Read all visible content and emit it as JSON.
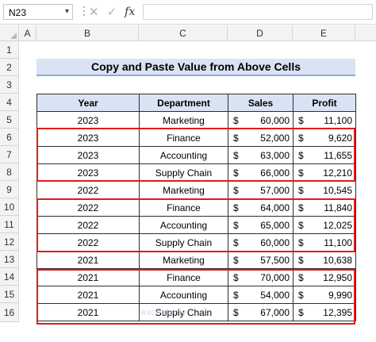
{
  "formula_bar": {
    "name_box": "N23",
    "cancel_icon": "✕",
    "enter_icon": "✓",
    "fx_label": "fx",
    "formula": ""
  },
  "columns": [
    "A",
    "B",
    "C",
    "D",
    "E"
  ],
  "rows": [
    "1",
    "2",
    "3",
    "4",
    "5",
    "6",
    "7",
    "8",
    "9",
    "10",
    "11",
    "12",
    "13",
    "14",
    "15",
    "16"
  ],
  "title": "Copy and Paste Value from Above Cells",
  "table": {
    "headers": [
      "Year",
      "Department",
      "Sales",
      "Profit"
    ],
    "currency": "$",
    "rows": [
      {
        "year": "2023",
        "department": "Marketing",
        "sales": "60,000",
        "profit": "11,100"
      },
      {
        "year": "2023",
        "department": "Finance",
        "sales": "52,000",
        "profit": "9,620"
      },
      {
        "year": "2023",
        "department": "Accounting",
        "sales": "63,000",
        "profit": "11,655"
      },
      {
        "year": "2023",
        "department": "Supply Chain",
        "sales": "66,000",
        "profit": "12,210"
      },
      {
        "year": "2022",
        "department": "Marketing",
        "sales": "57,000",
        "profit": "10,545"
      },
      {
        "year": "2022",
        "department": "Finance",
        "sales": "64,000",
        "profit": "11,840"
      },
      {
        "year": "2022",
        "department": "Accounting",
        "sales": "65,000",
        "profit": "12,025"
      },
      {
        "year": "2022",
        "department": "Supply Chain",
        "sales": "60,000",
        "profit": "11,100"
      },
      {
        "year": "2021",
        "department": "Marketing",
        "sales": "57,500",
        "profit": "10,638"
      },
      {
        "year": "2021",
        "department": "Finance",
        "sales": "70,000",
        "profit": "12,950"
      },
      {
        "year": "2021",
        "department": "Accounting",
        "sales": "54,000",
        "profit": "9,990"
      },
      {
        "year": "2021",
        "department": "Supply Chain",
        "sales": "67,000",
        "profit": "12,395"
      }
    ]
  },
  "highlight_color": "#e21b1b",
  "header_fill": "#dae3f3",
  "watermark": "exceldemy"
}
